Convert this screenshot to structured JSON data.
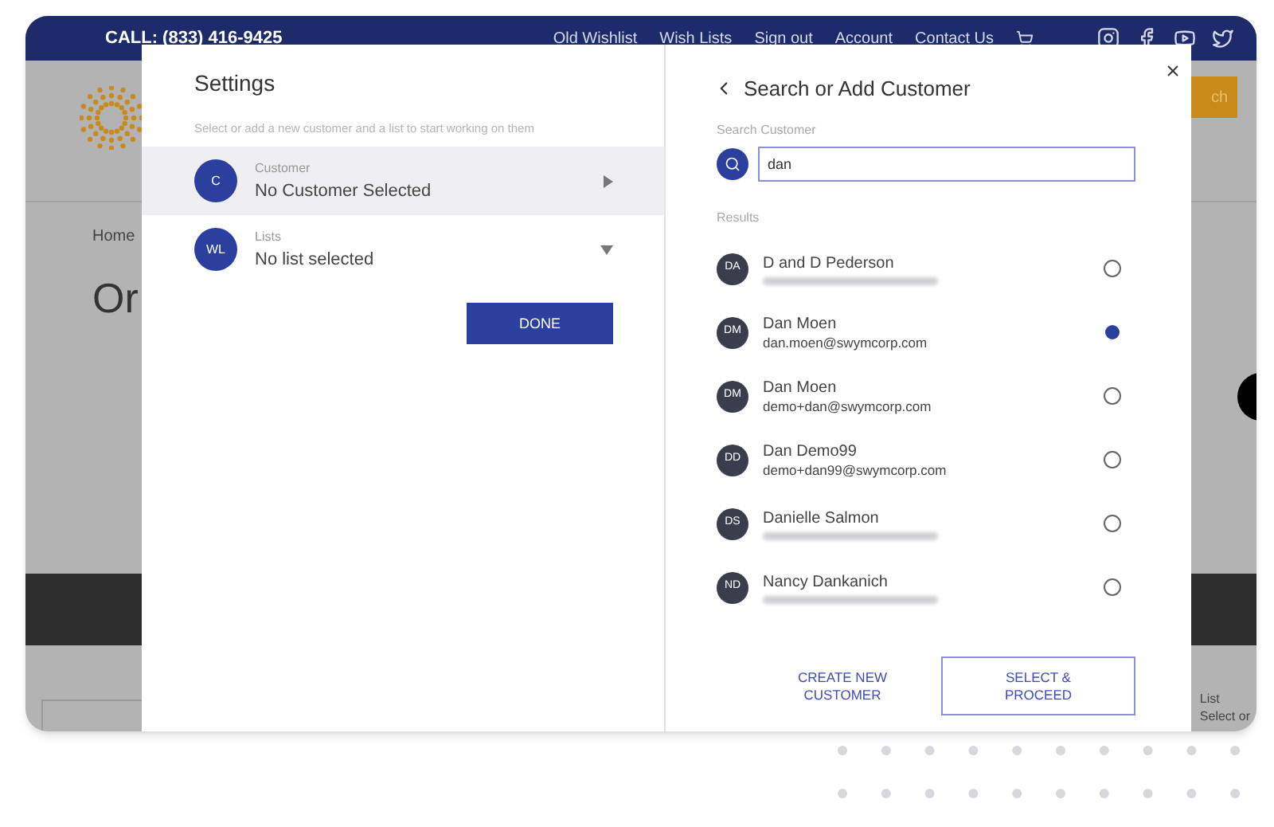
{
  "top_bar": {
    "phone": "CALL: (833) 416-9425",
    "links": [
      "Old Wishlist",
      "Wish Lists",
      "Sign out",
      "Account",
      "Contact Us"
    ]
  },
  "background_page": {
    "breadcrumb": "Home",
    "heading": "Or",
    "search_button": "ch",
    "list_label": "List",
    "list_value": "Select or"
  },
  "settings": {
    "title": "Settings",
    "subtitle": "Select or add a new customer and a list to start working on them",
    "rows": [
      {
        "kind": "submenu",
        "avatar": "C",
        "label": "Customer",
        "value": "No Customer Selected",
        "selected": true
      },
      {
        "kind": "dropdown",
        "avatar": "WL",
        "label": "Lists",
        "value": "No list selected",
        "selected": false
      }
    ],
    "done_button": "DONE"
  },
  "customer_search": {
    "title": "Search or Add Customer",
    "search_label": "Search Customer",
    "search_value": "dan",
    "results_label": "Results",
    "results": [
      {
        "avatar": "DA",
        "name": "D and D Pederson",
        "redacted": true,
        "selected": false
      },
      {
        "avatar": "DM",
        "name": "Dan Moen",
        "email": "dan.moen@swymcorp.com",
        "redacted": false,
        "selected": true
      },
      {
        "avatar": "DM",
        "name": "Dan Moen",
        "email": "demo+dan@swymcorp.com",
        "redacted": false,
        "selected": false
      },
      {
        "avatar": "DD",
        "name": "Dan Demo99",
        "email": "demo+dan99@swymcorp.com",
        "redacted": false,
        "selected": false
      },
      {
        "avatar": "DS",
        "name": "Danielle Salmon",
        "redacted": true,
        "selected": false
      },
      {
        "avatar": "ND",
        "name": "Nancy Dankanich",
        "redacted": true,
        "selected": false
      }
    ],
    "create_button": "CREATE NEW CUSTOMER",
    "proceed_button": "SELECT & PROCEED"
  }
}
